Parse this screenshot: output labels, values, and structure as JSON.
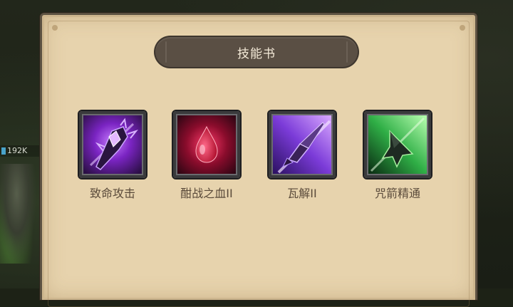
{
  "side_hud": {
    "hp_text": "192K"
  },
  "panel": {
    "title": "技能书",
    "skills": [
      {
        "label": "致命攻击",
        "icon": "purple-spiked-mace-icon",
        "colors": [
          "#2b0f45",
          "#9b3be0"
        ]
      },
      {
        "label": "酣战之血II",
        "icon": "blood-drop-icon",
        "colors": [
          "#3a0a1a",
          "#c0143c"
        ]
      },
      {
        "label": "瓦解II",
        "icon": "purple-spear-icon",
        "colors": [
          "#1c0f3d",
          "#7b3bd8"
        ]
      },
      {
        "label": "咒箭精通",
        "icon": "green-arrowhead-icon",
        "colors": [
          "#0a2a12",
          "#3fd25a"
        ]
      }
    ]
  }
}
